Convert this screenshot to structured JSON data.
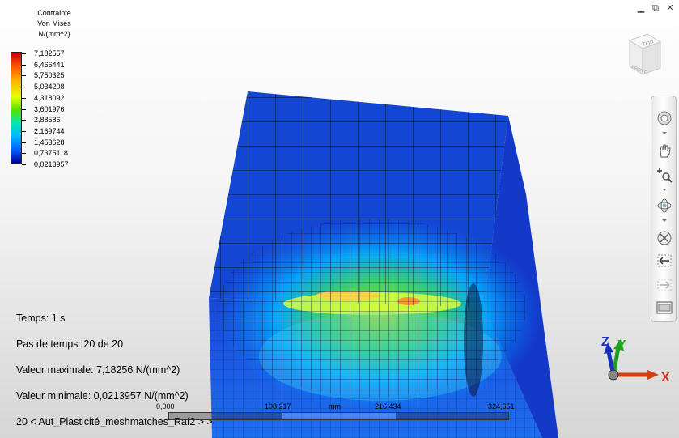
{
  "window": {
    "minimize_icon": "minimize-icon",
    "restore_icon": "restore-icon",
    "close_icon": "close-icon"
  },
  "legend": {
    "title_line1": "Contrainte",
    "title_line2": "Von Mises",
    "unit": "N/(mm^2)",
    "values": [
      "7,182557",
      "6,466441",
      "5,750325",
      "5,034208",
      "4,318092",
      "3,601976",
      "2,88586",
      "2,169744",
      "1,453628",
      "0,7375118",
      "0,0213957"
    ],
    "colors": {
      "max": "#c80000",
      "mid": "#5ae000",
      "min": "#0000a0"
    }
  },
  "info": {
    "time": "Temps: 1 s",
    "step": "Pas de temps: 20 de 20",
    "max_value": "Valeur maximale: 7,18256 N/(mm^2)",
    "min_value": "Valeur minimale: 0,0213957 N/(mm^2)",
    "study": "20 < Aut_Plasticité_meshmatches_Raf2 > >"
  },
  "scale_bar": {
    "label_0": "0,000",
    "label_1": "108,217",
    "unit": "mm",
    "label_2": "216,434",
    "label_3": "324,651"
  },
  "viewcube": {
    "top_label": "TOP",
    "front_label": "FRONT"
  },
  "triad": {
    "x_label": "X",
    "y_label": "Y",
    "z_label": "Z"
  }
}
